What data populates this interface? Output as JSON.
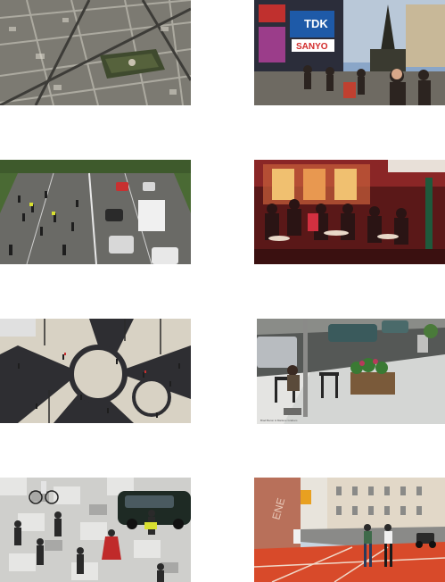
{
  "gallery": {
    "photos": [
      {
        "name": "aerial-city-park"
      },
      {
        "name": "piccadilly-circus",
        "signs": [
          "TDK",
          "SANYO"
        ]
      },
      {
        "name": "skaters-on-avenue"
      },
      {
        "name": "cafe-terrace"
      },
      {
        "name": "pedestrian-plaza-pattern"
      },
      {
        "name": "sidewalk-cafe-seating",
        "caption": "Brad Baron & Marlene Graham"
      },
      {
        "name": "paved-square-people"
      },
      {
        "name": "red-bike-lane-street",
        "wall_text": "ENE"
      }
    ]
  }
}
